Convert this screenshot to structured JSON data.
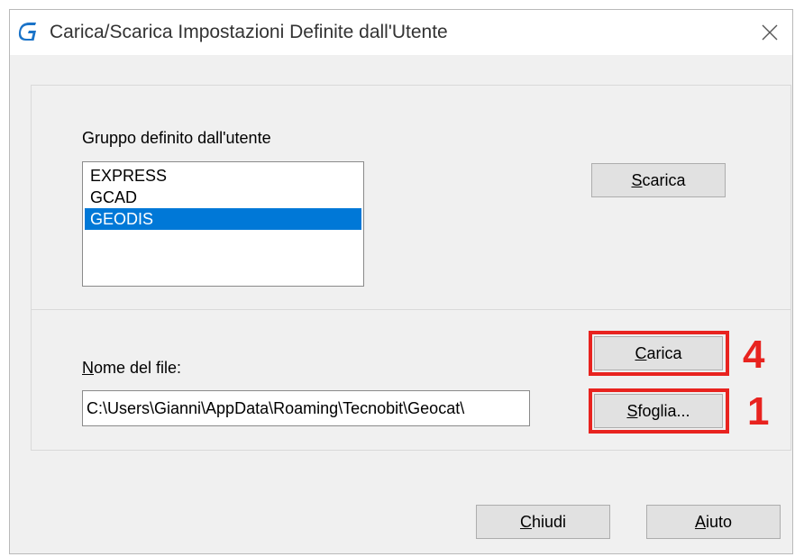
{
  "window": {
    "title": "Carica/Scarica Impostazioni Definite dall'Utente",
    "app_icon": "g-logo-icon",
    "close_icon": "close-icon"
  },
  "group": {
    "label": "Gruppo definito dall'utente",
    "items": [
      "EXPRESS",
      "GCAD",
      "GEODIS"
    ],
    "selected": "GEODIS"
  },
  "buttons": {
    "scarica": {
      "mnemonic": "S",
      "rest": "carica"
    },
    "carica": {
      "mnemonic": "C",
      "rest": "arica"
    },
    "sfoglia": {
      "mnemonic": "S",
      "rest": "foglia..."
    },
    "chiudi": {
      "mnemonic": "C",
      "rest": "hiudi"
    },
    "aiuto": {
      "mnemonic": "A",
      "rest": "iuto"
    }
  },
  "file": {
    "label_mnemonic": "N",
    "label_rest": "ome del file:",
    "value": "C:\\Users\\Gianni\\AppData\\Roaming\\Tecnobit\\Geocat\\"
  },
  "annotations": {
    "carica_step": "4",
    "sfoglia_step": "1",
    "highlight_color": "#e8231f"
  },
  "colors": {
    "selection": "#0078d7",
    "button_face": "#e1e1e1",
    "dialog_bg": "#f0f0f0"
  }
}
